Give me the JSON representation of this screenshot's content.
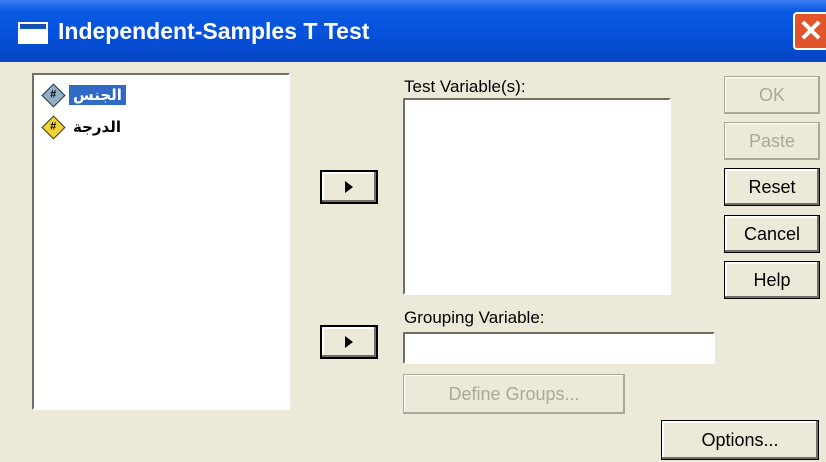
{
  "window": {
    "title": "Independent-Samples T Test",
    "close_glyph": "✕"
  },
  "variables": [
    {
      "label": "الجنس",
      "icon": "scale-variable-icon",
      "selected": true
    },
    {
      "label": "الدرجة",
      "icon": "scale-variable-icon",
      "selected": false
    }
  ],
  "test_variables": {
    "label": "Test Variable(s):"
  },
  "grouping": {
    "label": "Grouping Variable:",
    "value": "",
    "define_groups": "Define Groups..."
  },
  "buttons": {
    "ok": "OK",
    "paste": "Paste",
    "reset": "Reset",
    "cancel": "Cancel",
    "help": "Help",
    "options": "Options..."
  },
  "colors": {
    "title_bar": "#0550d8",
    "selection": "#316ac5",
    "dialog_bg": "#ece9d8",
    "close": "#e0552c"
  }
}
